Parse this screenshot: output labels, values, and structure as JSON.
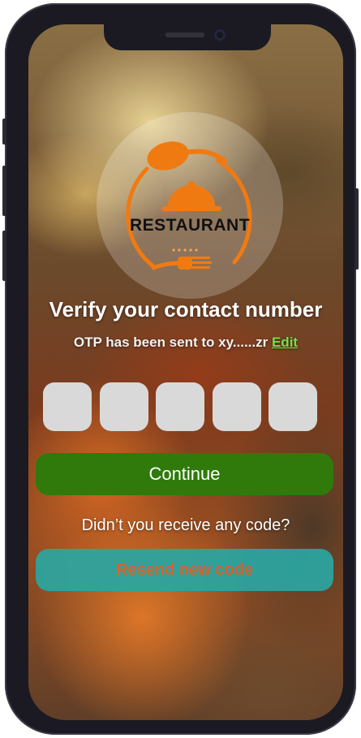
{
  "logo": {
    "brand_text": "RESTAURANT",
    "accent_color": "#f07a12",
    "icons": [
      "spoon-icon",
      "cloche-icon",
      "fork-icon"
    ]
  },
  "verify": {
    "title": "Verify your contact number",
    "otp_message": "OTP has been sent to xy......zr",
    "edit_label": "Edit"
  },
  "otp": {
    "digits": [
      "",
      "",
      "",
      "",
      ""
    ]
  },
  "actions": {
    "continue_label": "Continue",
    "no_code_text": "Didn’t you receive any code?",
    "resend_label": "Resend new code"
  },
  "colors": {
    "continue_bg": "#2f7a0a",
    "resend_bg": "#2aa6a2",
    "resend_text": "#e0622a",
    "edit_link": "#6fe24a",
    "otp_box": "#d9d9d9"
  }
}
